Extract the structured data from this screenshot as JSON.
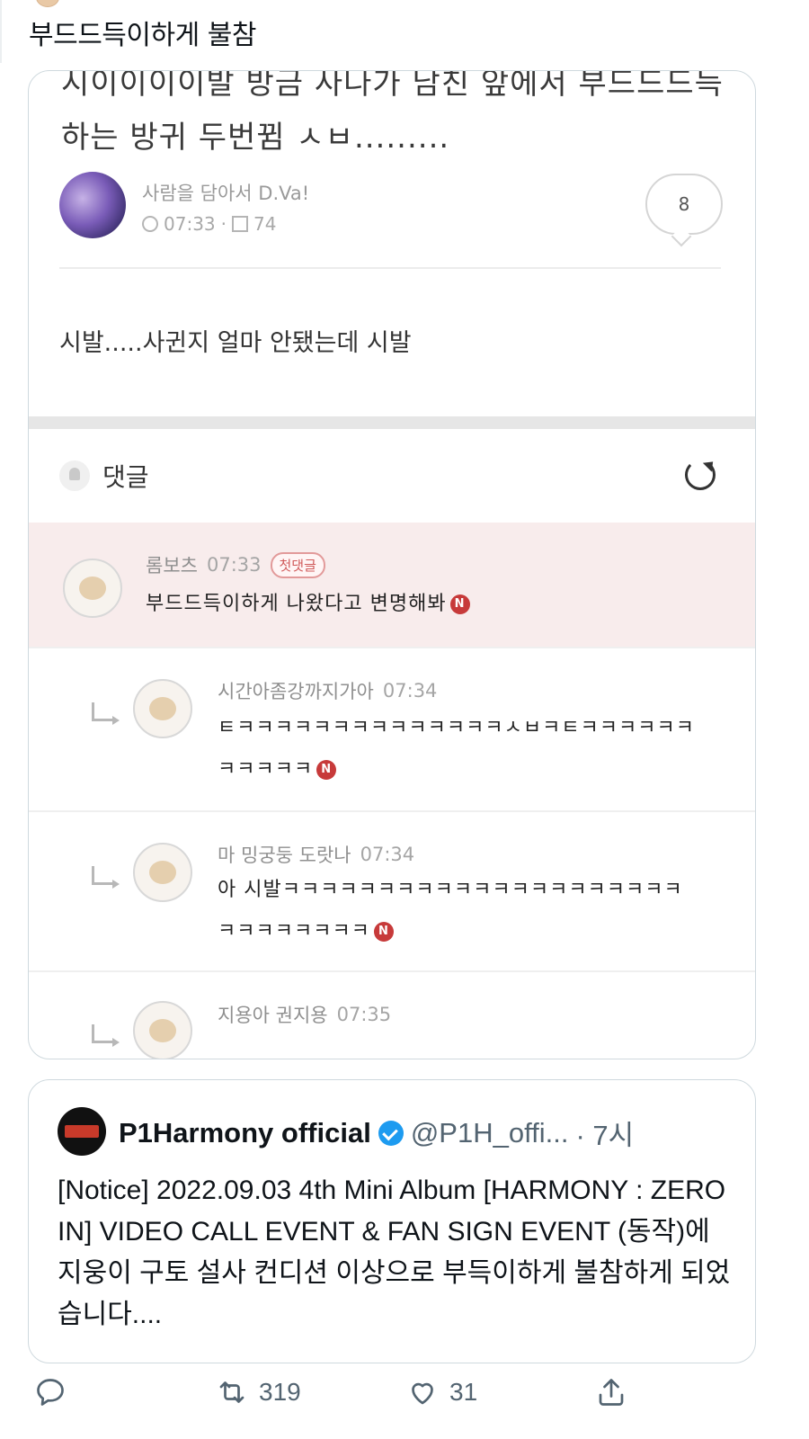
{
  "tweet": {
    "text": "부드드득이하게 불참"
  },
  "screenshot": {
    "title": "시이이이이발 방금 사나가 남친 앞에서 부드드드득하는 방귀 두번뀜 ㅅㅂ.........",
    "author": "사람을 담아서 D.Va!",
    "time": "07:33",
    "views": "74",
    "comment_count": "8",
    "body": "시발.....사귄지 얼마 안됐는데 시발",
    "comments_label": "댓글",
    "comments": [
      {
        "name": "롬보츠",
        "time": "07:33",
        "badge": "첫댓글",
        "text": "부드드득이하게 나왔다고 변명해봐"
      },
      {
        "name": "시간아좀강까지가아",
        "time": "07:34",
        "text_line1": "ㅌㅋㅋㅋㅋㅋㅋㅋㅋㅋㅋㅋㅋㅋㅋㅅㅂㅋㅌㅋㅋㅋㅋㅋㅋ",
        "text_line2": "ㅋㅋㅋㅋㅋ"
      },
      {
        "name": "마 밍궁둥 도랏나",
        "time": "07:34",
        "text_line1": "아 시발ㅋㅋㅋㅋㅋㅋㅋㅋㅋㅋㅋㅋㅋㅋㅋㅋㅋㅋㅋㅋㅋ",
        "text_line2": "ㅋㅋㅋㅋㅋㅋㅋㅋ"
      },
      {
        "name": "지용아 권지용",
        "time": "07:35"
      }
    ]
  },
  "quote": {
    "name": "P1Harmony official",
    "handle": "@P1H_offi...",
    "time": "· 7시",
    "text": "[Notice] 2022.09.03 4th Mini Album [HARMONY : ZERO IN] VIDEO CALL EVENT & FAN SIGN EVENT (동작)에 지웅이 구토 설사 컨디션 이상으로 부득이하게 불참하게 되었습니다...."
  },
  "actions": {
    "retweets": "319",
    "likes": "31"
  },
  "colors": {
    "verified": "#1d9bf0",
    "highlight_row": "#f8ecec",
    "new_badge": "#c73a3a"
  },
  "icons": [
    "reply-icon",
    "retweet-icon",
    "like-icon",
    "share-icon",
    "verified-icon",
    "refresh-icon",
    "bell-icon",
    "reply-arrow-icon",
    "new-badge-icon"
  ]
}
